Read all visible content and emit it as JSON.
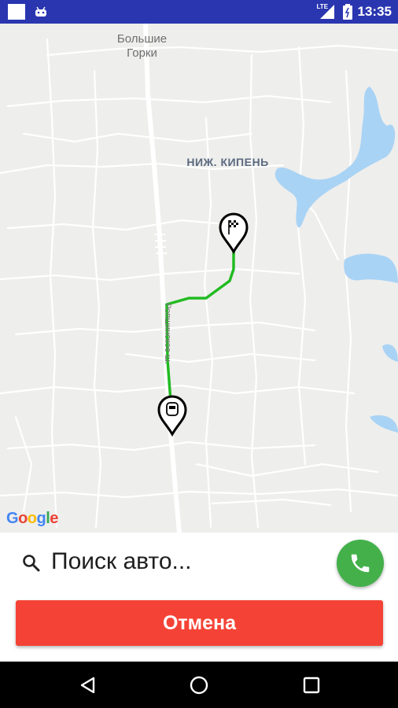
{
  "status_bar": {
    "network_label": "LTE",
    "time": "13:35",
    "icons": [
      "notification-square-icon",
      "android-icon",
      "signal-icon",
      "battery-icon"
    ]
  },
  "map": {
    "place_label": "Большие Горки",
    "area_label": "НИЖ. КИПЕНЬ",
    "road_label": "Ропшинское ш.",
    "attribution": [
      "G",
      "o",
      "o",
      "g",
      "l",
      "e"
    ],
    "attribution_colors": [
      "#4285F4",
      "#EA4335",
      "#FBBC05",
      "#4285F4",
      "#34A853",
      "#EA4335"
    ],
    "route_color": "#22bb22",
    "water_color": "#a9d3f5",
    "markers": [
      "destination-flag-marker",
      "car-origin-marker"
    ]
  },
  "panel": {
    "search_status": "Поиск авто...",
    "cancel_label": "Отмена",
    "call_button_color": "#44b04a",
    "cancel_button_color": "#f44336"
  },
  "nav": {
    "buttons": [
      "back-icon",
      "home-icon",
      "recents-icon"
    ]
  }
}
